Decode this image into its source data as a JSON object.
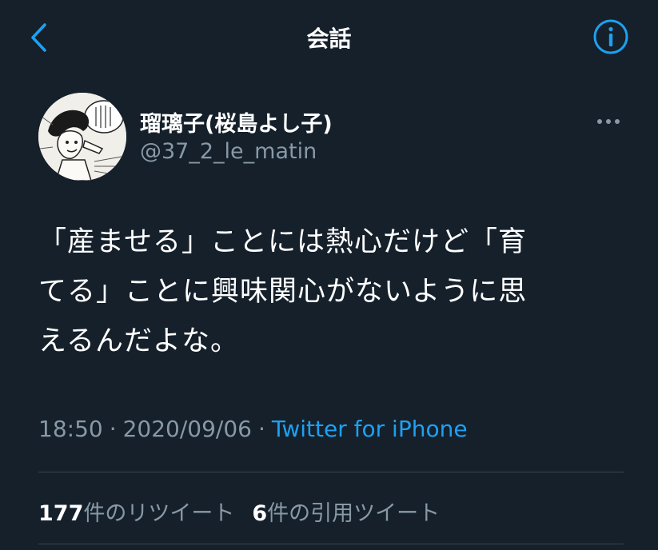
{
  "header": {
    "title": "会話",
    "back_icon": "chevron-left-icon",
    "info_icon": "info-icon"
  },
  "tweet": {
    "author_name": "瑠璃子(桜島よし子)",
    "author_handle": "@37_2_le_matin",
    "text": "「産ませる」ことには熱心だけど「育\nてる」ことに興味関心がないように思\nえるんだよな。",
    "time": "18:50",
    "date": "2020/09/06",
    "separator": "·",
    "source": "Twitter for iPhone"
  },
  "stats": {
    "retweets_count": "177",
    "retweets_label": "件のリツイート",
    "quotes_count": "6",
    "quotes_label": "件の引用ツイート"
  },
  "colors": {
    "background": "#15202b",
    "accent": "#1da1f2",
    "secondary_text": "#8899a6",
    "divider": "#38444d"
  }
}
